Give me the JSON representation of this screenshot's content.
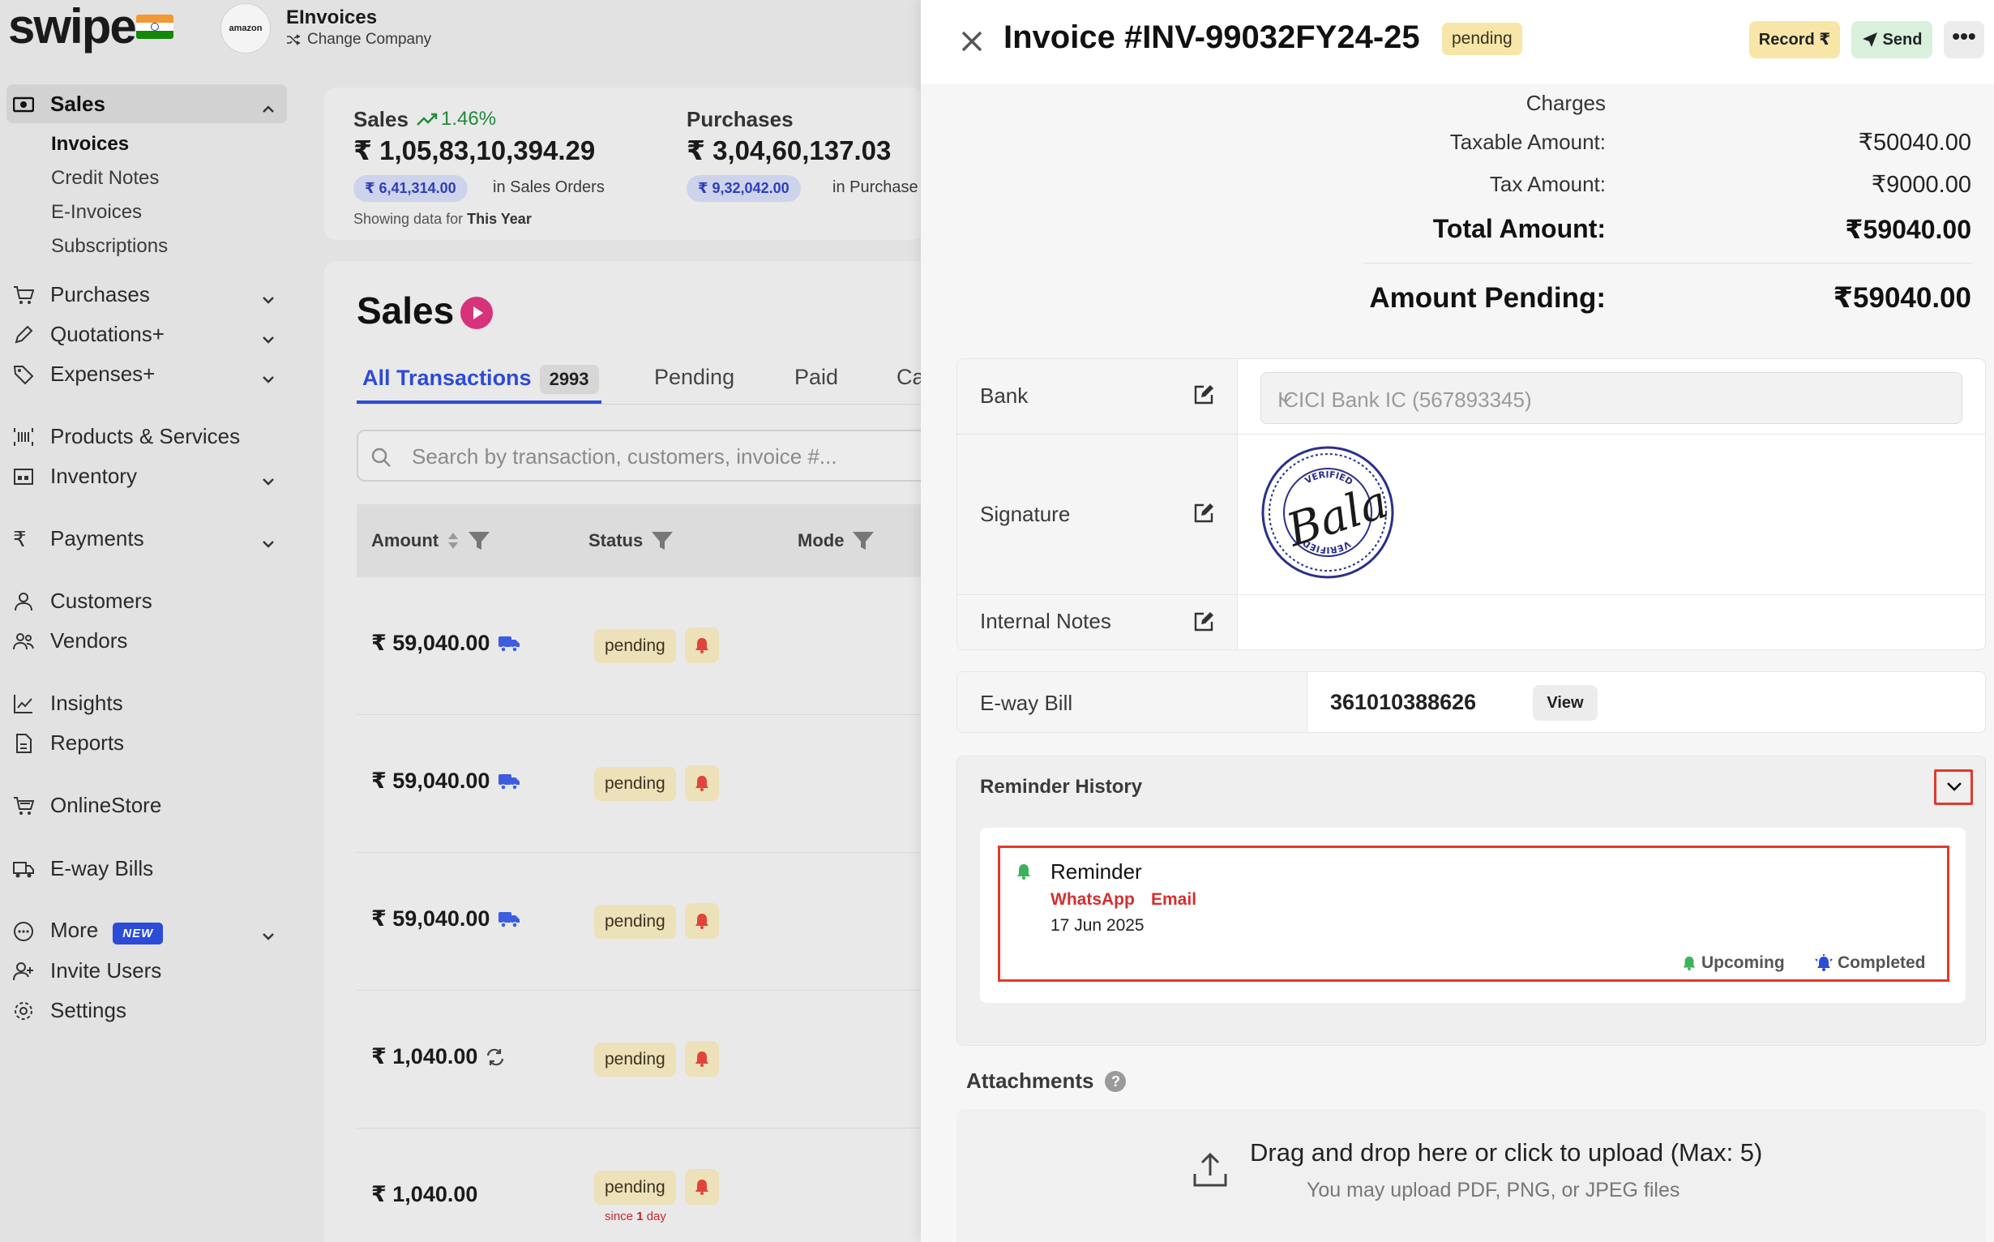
{
  "brand": {
    "logo_text": "swipe",
    "flag": "india-flag"
  },
  "company": {
    "logo_text": "amazon",
    "name": "EInvoices",
    "change_label": "Change Company"
  },
  "sidebar": {
    "sales": {
      "label": "Sales",
      "icon": "cash-icon"
    },
    "sales_sub": [
      "Invoices",
      "Credit Notes",
      "E-Invoices",
      "Subscriptions"
    ],
    "items": [
      {
        "label": "Purchases",
        "icon": "cart-icon"
      },
      {
        "label": "Quotations+",
        "icon": "pencil-icon"
      },
      {
        "label": "Expenses+",
        "icon": "tag-icon"
      },
      {
        "label": "Products & Services",
        "icon": "barcode-icon"
      },
      {
        "label": "Inventory",
        "icon": "warehouse-icon"
      },
      {
        "label": "Payments",
        "icon": "rupee-icon"
      },
      {
        "label": "Customers",
        "icon": "user-icon"
      },
      {
        "label": "Vendors",
        "icon": "users-icon"
      },
      {
        "label": "Insights",
        "icon": "chart-icon"
      },
      {
        "label": "Reports",
        "icon": "report-icon"
      },
      {
        "label": "OnlineStore",
        "icon": "store-icon"
      },
      {
        "label": "E-way Bills",
        "icon": "truck-icon"
      },
      {
        "label": "More",
        "icon": "more-circle-icon",
        "badge": "NEW"
      },
      {
        "label": "Invite Users",
        "icon": "user-plus-icon"
      },
      {
        "label": "Settings",
        "icon": "gear-icon"
      }
    ]
  },
  "stats": {
    "sales_label": "Sales",
    "sales_trend": "1.46%",
    "sales_value": "₹ 1,05,83,10,394.29",
    "sales_pill": "₹ 6,41,314.00",
    "sales_pill_suffix": "in Sales Orders",
    "purchases_label": "Purchases",
    "purchases_value": "₹ 3,04,60,137.03",
    "purchases_pill": "₹ 9,32,042.00",
    "purchases_pill_suffix": "in Purchase",
    "note_prefix": "Showing data for",
    "note_period": "This Year"
  },
  "list": {
    "heading": "Sales",
    "tabs": [
      {
        "label": "All Transactions",
        "count": "2993"
      },
      {
        "label": "Pending"
      },
      {
        "label": "Paid"
      },
      {
        "label": "Ca"
      }
    ],
    "search_placeholder": "Search by transaction, customers, invoice #...",
    "columns": [
      "Amount",
      "Status",
      "Mode"
    ],
    "rows": [
      {
        "amount": "₹ 59,040.00",
        "icon": "truck-icon",
        "status": "pending"
      },
      {
        "amount": "₹ 59,040.00",
        "icon": "truck-icon",
        "status": "pending"
      },
      {
        "amount": "₹ 59,040.00",
        "icon": "truck-icon",
        "status": "pending"
      },
      {
        "amount": "₹ 1,040.00",
        "icon": "recurring-icon",
        "status": "pending"
      },
      {
        "amount": "₹ 1,040.00",
        "icon": "",
        "status": "pending",
        "since_prefix": "since",
        "since_num": "1",
        "since_unit": "day"
      }
    ]
  },
  "panel": {
    "title": "Invoice #INV-99032FY24-25",
    "status": "pending",
    "record_label": "Record ₹",
    "send_label": "Send",
    "more_label": "•••",
    "summary": {
      "charges_label": "Charges",
      "taxable_label": "Taxable Amount:",
      "taxable_value": "₹50040.00",
      "tax_label": "Tax Amount:",
      "tax_value": "₹9000.00",
      "total_label": "Total Amount:",
      "total_value": "₹59040.00",
      "pending_label": "Amount Pending:",
      "pending_value": "₹59040.00"
    },
    "details": {
      "bank_label": "Bank",
      "bank_value": "ICICI Bank IC (567893345)",
      "signature_label": "Signature",
      "seal_text_top": "VERIFIED",
      "seal_text_bottom": "VERIFIED",
      "signature_text": "Bala",
      "notes_label": "Internal Notes"
    },
    "eway": {
      "label": "E-way Bill",
      "number": "361010388626",
      "view_label": "View"
    },
    "reminder": {
      "title": "Reminder History",
      "item_title": "Reminder",
      "channels": [
        "WhatsApp",
        "Email"
      ],
      "date": "17 Jun 2025",
      "legend_upcoming": "Upcoming",
      "legend_completed": "Completed"
    },
    "attachments": {
      "title": "Attachments",
      "help": "?",
      "upload_main": "Drag and drop here or click to upload (Max: 5)",
      "upload_sub": "You may upload PDF, PNG, or JPEG files"
    }
  },
  "colors": {
    "accent": "#2c4bd6",
    "pending": "#ece1b9",
    "highlight": "#e03a2b",
    "green": "#1f8a3a",
    "red": "#d32f2f"
  }
}
